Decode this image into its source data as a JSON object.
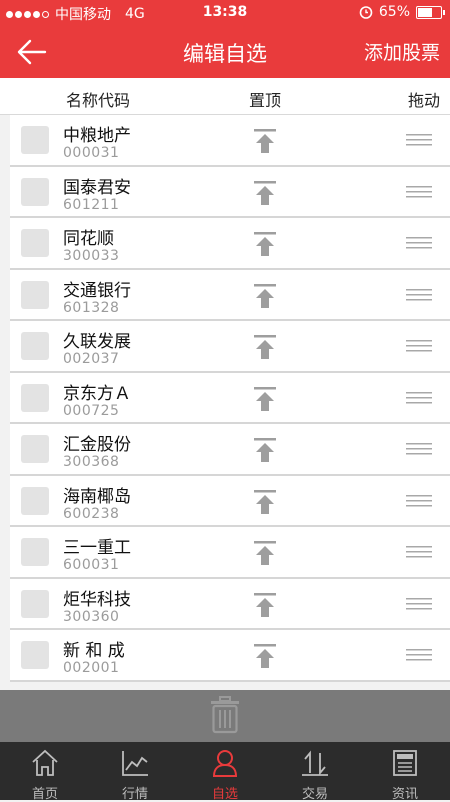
{
  "status": {
    "carrier": "中国移动",
    "network": "4G",
    "time": "13:38",
    "battery": "65%",
    "battery_level": 0.65
  },
  "nav": {
    "title": "编辑自选",
    "add_label": "添加股票"
  },
  "header": {
    "name_code": "名称代码",
    "pin_top": "置顶",
    "drag": "拖动"
  },
  "stocks": [
    {
      "name": "中粮地产",
      "code": "000031"
    },
    {
      "name": "国泰君安",
      "code": "601211"
    },
    {
      "name": "同花顺",
      "code": "300033"
    },
    {
      "name": "交通银行",
      "code": "601328"
    },
    {
      "name": "久联发展",
      "code": "002037"
    },
    {
      "name": "京东方Ａ",
      "code": "000725"
    },
    {
      "name": "汇金股份",
      "code": "300368"
    },
    {
      "name": "海南椰岛",
      "code": "600238"
    },
    {
      "name": "三一重工",
      "code": "600031"
    },
    {
      "name": "炬华科技",
      "code": "300360"
    },
    {
      "name": "新 和 成",
      "code": "002001"
    }
  ],
  "tabs": [
    {
      "label": "首页",
      "icon": "home-icon"
    },
    {
      "label": "行情",
      "icon": "chart-icon"
    },
    {
      "label": "自选",
      "icon": "person-icon",
      "active": true
    },
    {
      "label": "交易",
      "icon": "exchange-icon"
    },
    {
      "label": "资讯",
      "icon": "news-icon"
    }
  ],
  "colors": {
    "accent": "#e93b3c",
    "tab_bg": "#2c2c2c",
    "delete_bar": "#7a7a7a"
  }
}
